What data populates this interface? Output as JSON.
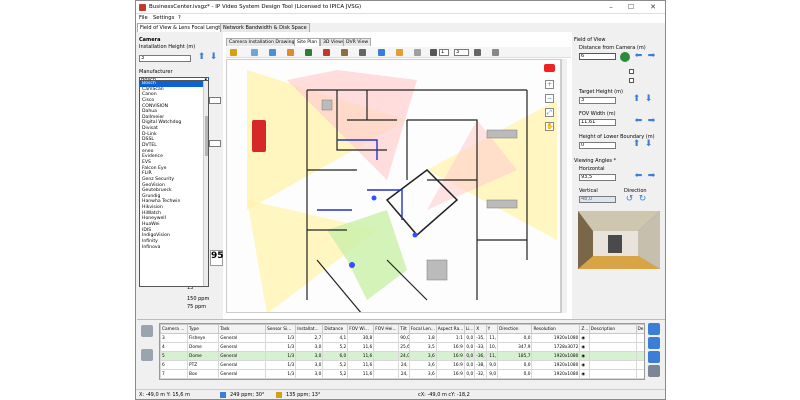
{
  "window": {
    "title": "BusinessCenter.ivsgz* - IP Video System Design Tool (Licensed to IPICA JVSG)",
    "min": "–",
    "max": "☐",
    "close": "✕"
  },
  "menu": {
    "file": "File",
    "settings": "Settings",
    "help": "?"
  },
  "main_tabs": [
    "Field of View & Lens Focal Length",
    "Network Bandwidth & Disk Space"
  ],
  "left": {
    "camera_label": "Camera",
    "install_height_label": "Installation Height (m)",
    "install_height_value": "3",
    "manufacturer_label": "Manufacturer",
    "manufacturer_value": "Bosch",
    "manufacturers": [
      "Bosch",
      "CamScan",
      "Canon",
      "Cisco",
      "CONVISION",
      "Dahua",
      "Dallmeier",
      "Digital Watchdog",
      "Divisat",
      "D-Link",
      "DSSL",
      "DVTEL",
      "eneo",
      "Evidence",
      "EVS",
      "Falcon Eye",
      "FLIR",
      "Genz Security",
      "GeoVision",
      "Geutebrueck",
      "Grundig",
      "Hanwha Techwin",
      "Hikvision",
      "HiWatch",
      "Honeywell",
      "HuaWei",
      "IDIS",
      "IndigoVision",
      "Infinity",
      "Infinova"
    ],
    "ppm1": "150 ppm",
    "ppm2": "75 ppm",
    "angle": "13°",
    "side_number": "95"
  },
  "view_tabs": [
    "Camera Installation Drawing",
    "Site Plan",
    "3D Views",
    "DVR View"
  ],
  "toolbar": {
    "zoom1": "1",
    "zoom2": "3"
  },
  "right": {
    "fov_label": "Field of View",
    "distance_label": "Distance from Camera (m)",
    "distance_value": "6",
    "target_label": "Target Height (m)",
    "target_value": "3",
    "fov_width_label": "FOV Width (m)",
    "fov_width_value": "11,61",
    "lower_label": "Height of Lower Boundary (m)",
    "lower_value": "0",
    "viewing_label": "Viewing Angles *",
    "horizontal_label": "Horizontal",
    "horizontal_value": "93,5",
    "vertical_label": "Vertical",
    "vertical_value": "48,0",
    "direction_label": "Direction"
  },
  "table": {
    "headers": [
      "Camera ...",
      "Type",
      "Task",
      "Sensor Si...",
      "Installat...",
      "Distance",
      "FOV Wi...",
      "FOV Hei...",
      "Tilt",
      "Focal Len...",
      "Aspect Ra...",
      "Li...",
      "X",
      "Y",
      "Direction",
      "Resolution",
      "Z...",
      "Description",
      "De..."
    ],
    "rows": [
      [
        "3",
        "Fisheye",
        "General",
        "1/3",
        "2,7",
        "4,1",
        "30,8",
        "",
        "90,0",
        "1,8",
        "1:1",
        "0,0",
        "-35,",
        "11,",
        "0,0",
        "1920x1080",
        "◉",
        "",
        ""
      ],
      [
        "4",
        "Dome",
        "General",
        "1/3",
        "3,0",
        "5,2",
        "11,6",
        "",
        "25,6",
        "3,5",
        "16:9",
        "0,0",
        "-33,",
        "10,",
        "347,9",
        "1728x3072",
        "◉",
        "",
        ""
      ],
      [
        "5",
        "Dome",
        "General",
        "1/3",
        "3,0",
        "6,0",
        "11,6",
        "",
        "24,0",
        "3,6",
        "16:9",
        "0,0",
        "-36,",
        "11,",
        "185,7",
        "1920x1080",
        "◉",
        "",
        ""
      ],
      [
        "6",
        "PTZ",
        "General",
        "1/3",
        "3,0",
        "5,2",
        "11,6",
        "",
        "24,",
        "3,6",
        "16:9",
        "0,0",
        "-38,",
        "9,0",
        "0,0",
        "1920x1080",
        "◉",
        "",
        ""
      ],
      [
        "7",
        "Box",
        "General",
        "1/3",
        "3,0",
        "5,2",
        "11,6",
        "",
        "24,",
        "3,6",
        "16:9",
        "0,0",
        "-32,",
        "9,0",
        "0,0",
        "1920x1080",
        "◉",
        "",
        ""
      ]
    ]
  },
  "status": {
    "coords": "X: -49,0 m     Y: 15,6 m",
    "ppm1": "249 ppm; 30°",
    "ppm2": "135 ppm; 13°",
    "cxcy": "cX: -49,0 m  cY: -18,2"
  },
  "colors": {
    "accent": "#0a64d7",
    "selected_row": "#d7f0d1",
    "fov_yellow": "#fff2a8",
    "fov_red": "#ffcfcf",
    "fov_green": "#c9f0a8"
  }
}
